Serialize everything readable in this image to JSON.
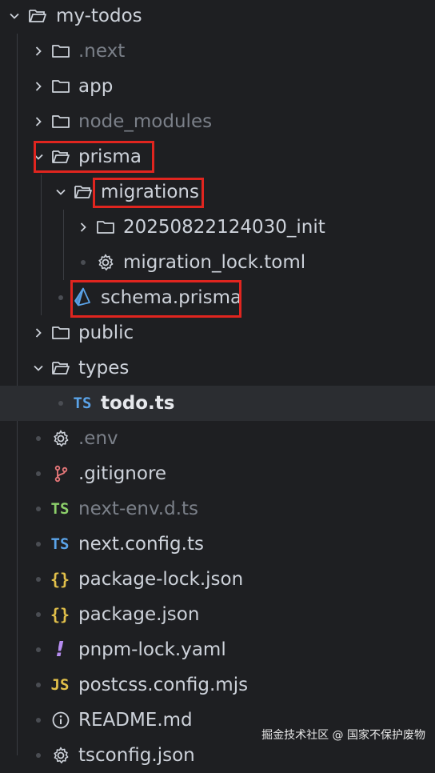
{
  "explorer": {
    "root": {
      "label": "my-todos"
    },
    "items": [
      {
        "label": ".next"
      },
      {
        "label": "app"
      },
      {
        "label": "node_modules"
      },
      {
        "label": "prisma"
      },
      {
        "label": "migrations"
      },
      {
        "label": "20250822124030_init"
      },
      {
        "label": "migration_lock.toml"
      },
      {
        "label": "schema.prisma"
      },
      {
        "label": "public"
      },
      {
        "label": "types"
      },
      {
        "label": "todo.ts"
      },
      {
        "label": ".env"
      },
      {
        "label": ".gitignore"
      },
      {
        "label": "next-env.d.ts"
      },
      {
        "label": "next.config.ts"
      },
      {
        "label": "package-lock.json"
      },
      {
        "label": "package.json"
      },
      {
        "label": "pnpm-lock.yaml"
      },
      {
        "label": "postcss.config.mjs"
      },
      {
        "label": "README.md"
      },
      {
        "label": "tsconfig.json"
      }
    ],
    "badges": {
      "ts": "TS",
      "js": "JS",
      "json": "{}",
      "yaml": "!"
    }
  },
  "colors": {
    "highlight": "#e0251f",
    "background": "#1e1f22"
  },
  "watermark": "掘金技术社区 @ 国家不保护废物"
}
